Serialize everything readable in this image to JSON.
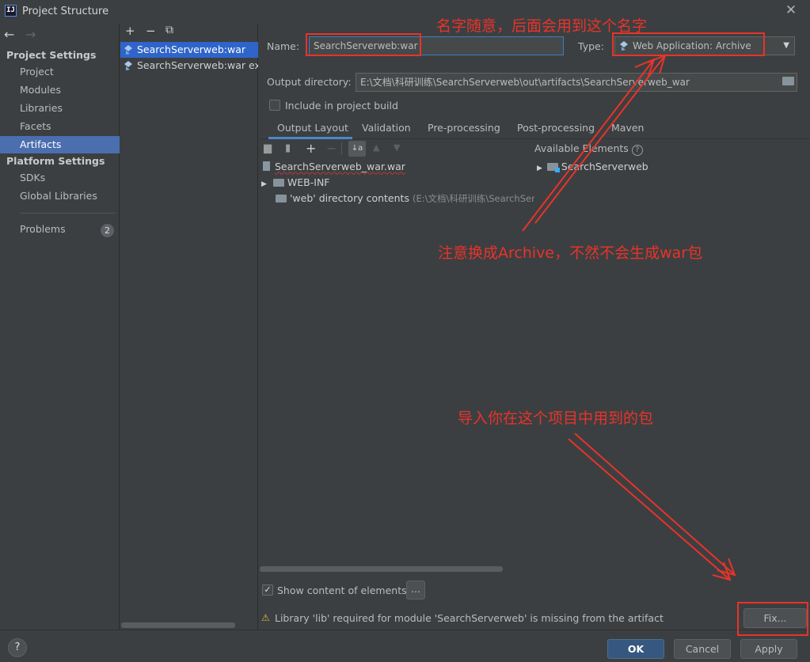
{
  "window": {
    "title": "Project Structure",
    "app_icon": "IJ"
  },
  "nav": {
    "back": "←",
    "forward": "→",
    "project_settings_header": "Project Settings",
    "project_settings_items": [
      "Project",
      "Modules",
      "Libraries",
      "Facets",
      "Artifacts"
    ],
    "platform_settings_header": "Platform Settings",
    "platform_settings_items": [
      "SDKs",
      "Global Libraries"
    ],
    "problems_label": "Problems",
    "problems_count": "2",
    "selected": "Artifacts"
  },
  "artifacts_list": {
    "toolbar": {
      "add": "+",
      "remove": "−",
      "copy": "⧉"
    },
    "items": [
      {
        "label": "SearchServerweb:war"
      },
      {
        "label": "SearchServerweb:war exploded"
      }
    ]
  },
  "artifact": {
    "name_label": "Name:",
    "name_value": "SearchServerweb:war",
    "type_label": "Type:",
    "type_value": "Web Application: Archive",
    "output_dir_label": "Output directory:",
    "output_dir_value": "E:\\文档\\科研训练\\SearchServerweb\\out\\artifacts\\SearchServerweb_war",
    "include_in_build_label": "Include in project build",
    "include_in_build": false
  },
  "tabs": [
    "Output Layout",
    "Validation",
    "Pre-processing",
    "Post-processing",
    "Maven"
  ],
  "active_tab": "Output Layout",
  "layout_tree": [
    {
      "label": "SearchServerweb_war.war",
      "extra": ""
    },
    {
      "label": "WEB-INF",
      "extra": ""
    },
    {
      "label": "'web' directory contents",
      "extra": "(E:\\文档\\科研训练\\SearchServ"
    }
  ],
  "available": {
    "header": "Available Elements",
    "help": "?",
    "items": [
      "SearchServerweb"
    ]
  },
  "show_content_label": "Show content of elements",
  "show_content": true,
  "more_button": "...",
  "warning_text": "Library 'lib' required for module 'SearchServerweb' is missing from the artifact",
  "buttons": {
    "fix": "Fix...",
    "ok": "OK",
    "cancel": "Cancel",
    "apply": "Apply",
    "help": "?"
  },
  "annotations": {
    "name_note": "名字随意，后面会用到这个名字",
    "archive_note": "注意换成Archive，不然不会生成war包",
    "fix_note": "导入你在这个项目中用到的包"
  },
  "colors": {
    "annotation_red": "#e8332a",
    "selection_blue": "#4b6eaf",
    "primary_button": "#365880"
  }
}
